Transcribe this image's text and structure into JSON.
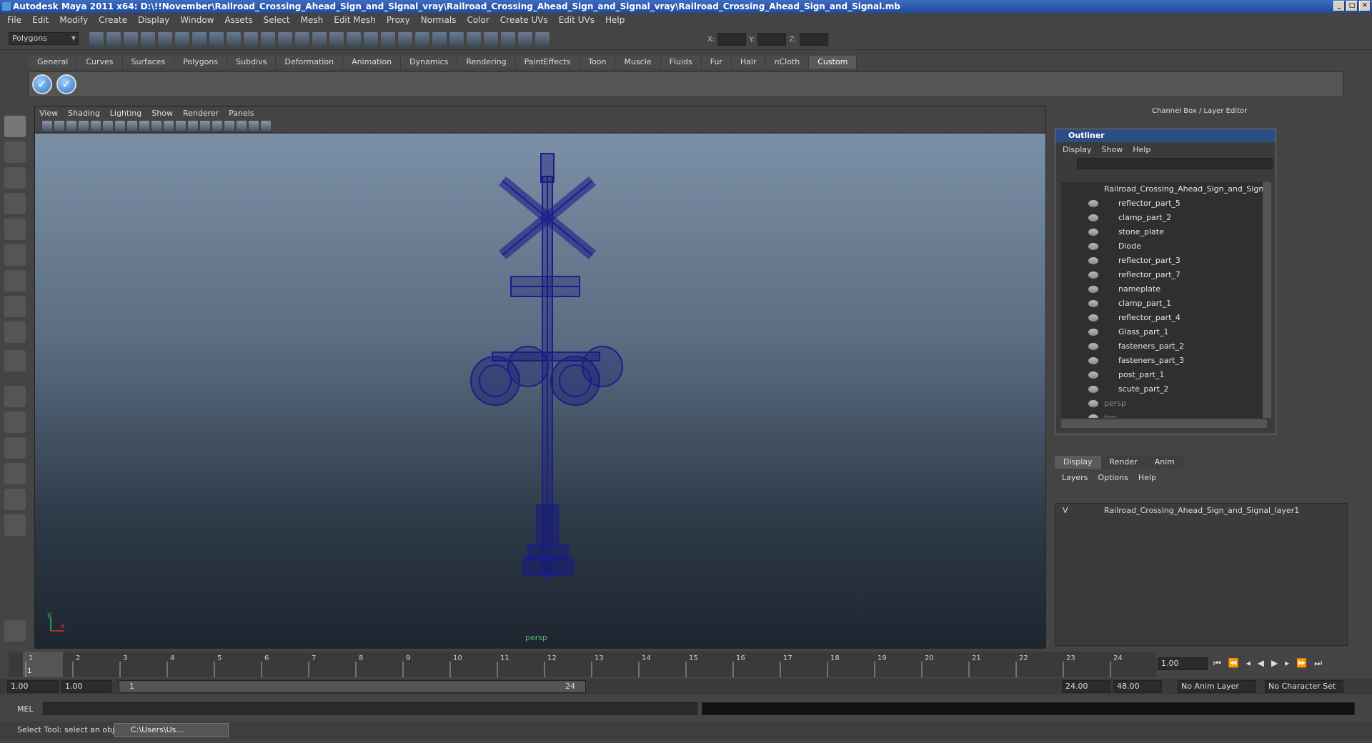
{
  "window": {
    "title": "Autodesk Maya 2011 x64: D:\\!!November\\Railroad_Crossing_Ahead_Sign_and_Signal_vray\\Railroad_Crossing_Ahead_Sign_and_Signal_vray\\Railroad_Crossing_Ahead_Sign_and_Signal.mb"
  },
  "menu": [
    "File",
    "Edit",
    "Modify",
    "Create",
    "Display",
    "Window",
    "Assets",
    "Select",
    "Mesh",
    "Edit Mesh",
    "Proxy",
    "Normals",
    "Color",
    "Create UVs",
    "Edit UVs",
    "Help"
  ],
  "toolbar": {
    "mode": "Polygons",
    "x_label": "X:",
    "y_label": "Y:",
    "z_label": "Z:"
  },
  "shelf_tabs": [
    "General",
    "Curves",
    "Surfaces",
    "Polygons",
    "Subdivs",
    "Deformation",
    "Animation",
    "Dynamics",
    "Rendering",
    "PaintEffects",
    "Toon",
    "Muscle",
    "Fluids",
    "Fur",
    "Hair",
    "nCloth",
    "Custom"
  ],
  "viewport": {
    "menu": [
      "View",
      "Shading",
      "Lighting",
      "Show",
      "Renderer",
      "Panels"
    ],
    "camera": "persp",
    "axis_y": "y",
    "axis_x": "x"
  },
  "channel_box": {
    "title": "Channel Box / Layer Editor"
  },
  "outliner": {
    "title": "Outliner",
    "menu": [
      "Display",
      "Show",
      "Help"
    ],
    "root": "Railroad_Crossing_Ahead_Sign_and_Signal",
    "items": [
      "reflector_part_5",
      "clamp_part_2",
      "stone_plate",
      "Diode",
      "reflector_part_3",
      "reflector_part_7",
      "nameplate",
      "clamp_part_1",
      "reflector_part_4",
      "Glass_part_1",
      "fasteners_part_2",
      "fasteners_part_3",
      "post_part_1",
      "scute_part_2"
    ],
    "cameras": [
      "persp",
      "top"
    ]
  },
  "layer_editor": {
    "tabs": [
      "Display",
      "Render",
      "Anim"
    ],
    "menu": [
      "Layers",
      "Options",
      "Help"
    ],
    "layer_visible": "V",
    "layer_name": "Railroad_Crossing_Ahead_Sign_and_Signal_layer1"
  },
  "timeline": {
    "ticks": [
      "1",
      "2",
      "3",
      "4",
      "5",
      "6",
      "7",
      "8",
      "9",
      "10",
      "11",
      "12",
      "13",
      "14",
      "15",
      "16",
      "17",
      "18",
      "19",
      "20",
      "21",
      "22",
      "23",
      "24"
    ],
    "current_frame": "1.00",
    "current_marker": "1"
  },
  "range": {
    "start": "1.00",
    "start2": "1.00",
    "slider_start": "1",
    "slider_end": "24",
    "end": "24.00",
    "end2": "48.00",
    "anim_layer": "No Anim Layer",
    "char_set": "No Character Set"
  },
  "command": {
    "label": "MEL"
  },
  "status": {
    "help": "Select Tool: select an object",
    "taskbar": "C:\\Users\\Us..."
  }
}
